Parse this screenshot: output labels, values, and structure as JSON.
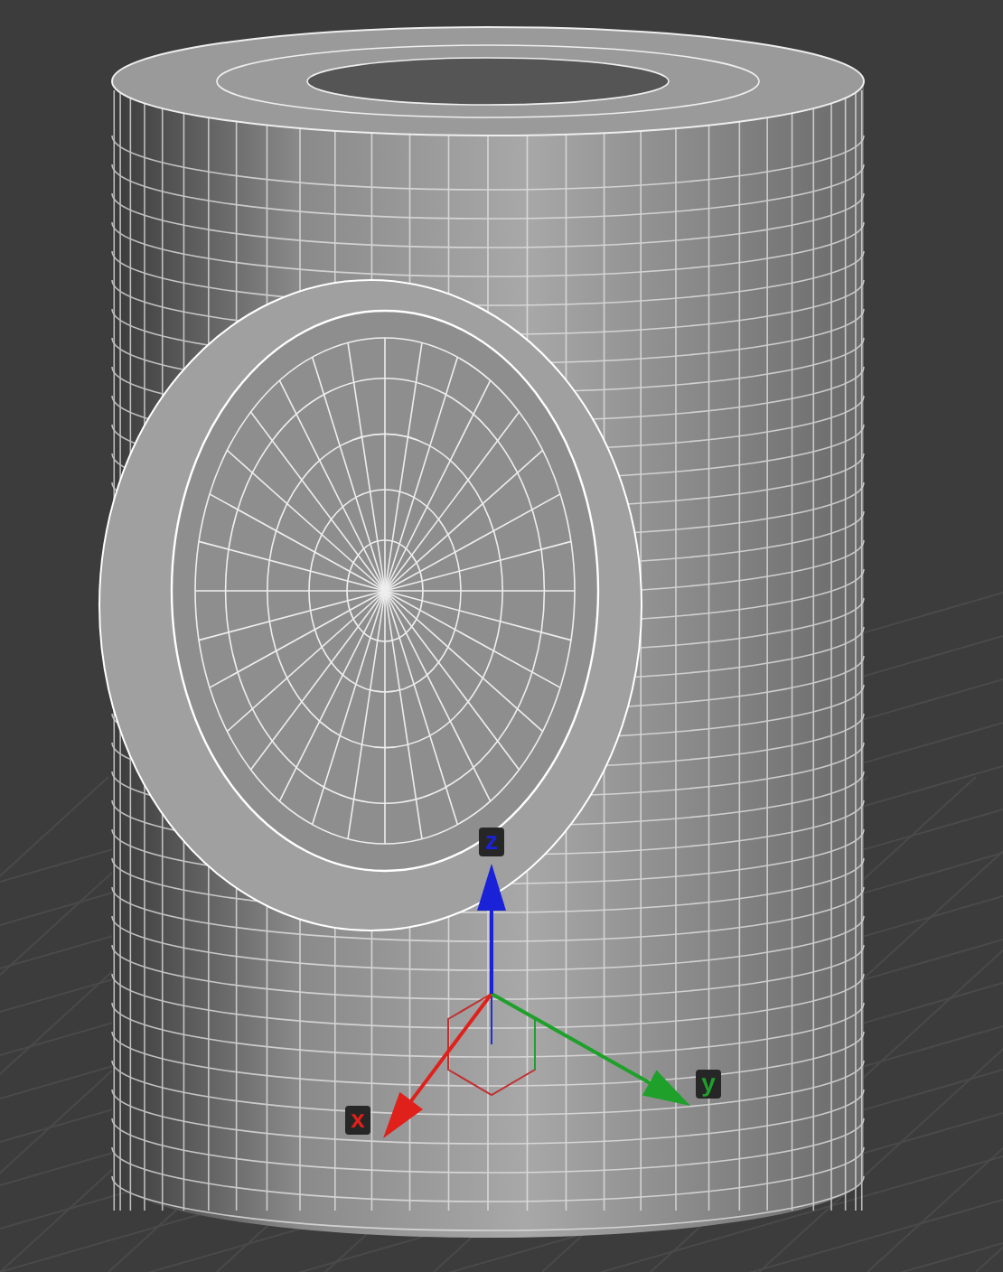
{
  "viewport": {
    "gizmo": {
      "axes": [
        {
          "kind": "x",
          "label": "x",
          "color": "#e0201a"
        },
        {
          "kind": "y",
          "label": "y",
          "color": "#1fa02a"
        },
        {
          "kind": "z",
          "label": "z",
          "color": "#1a22d8"
        }
      ]
    }
  }
}
